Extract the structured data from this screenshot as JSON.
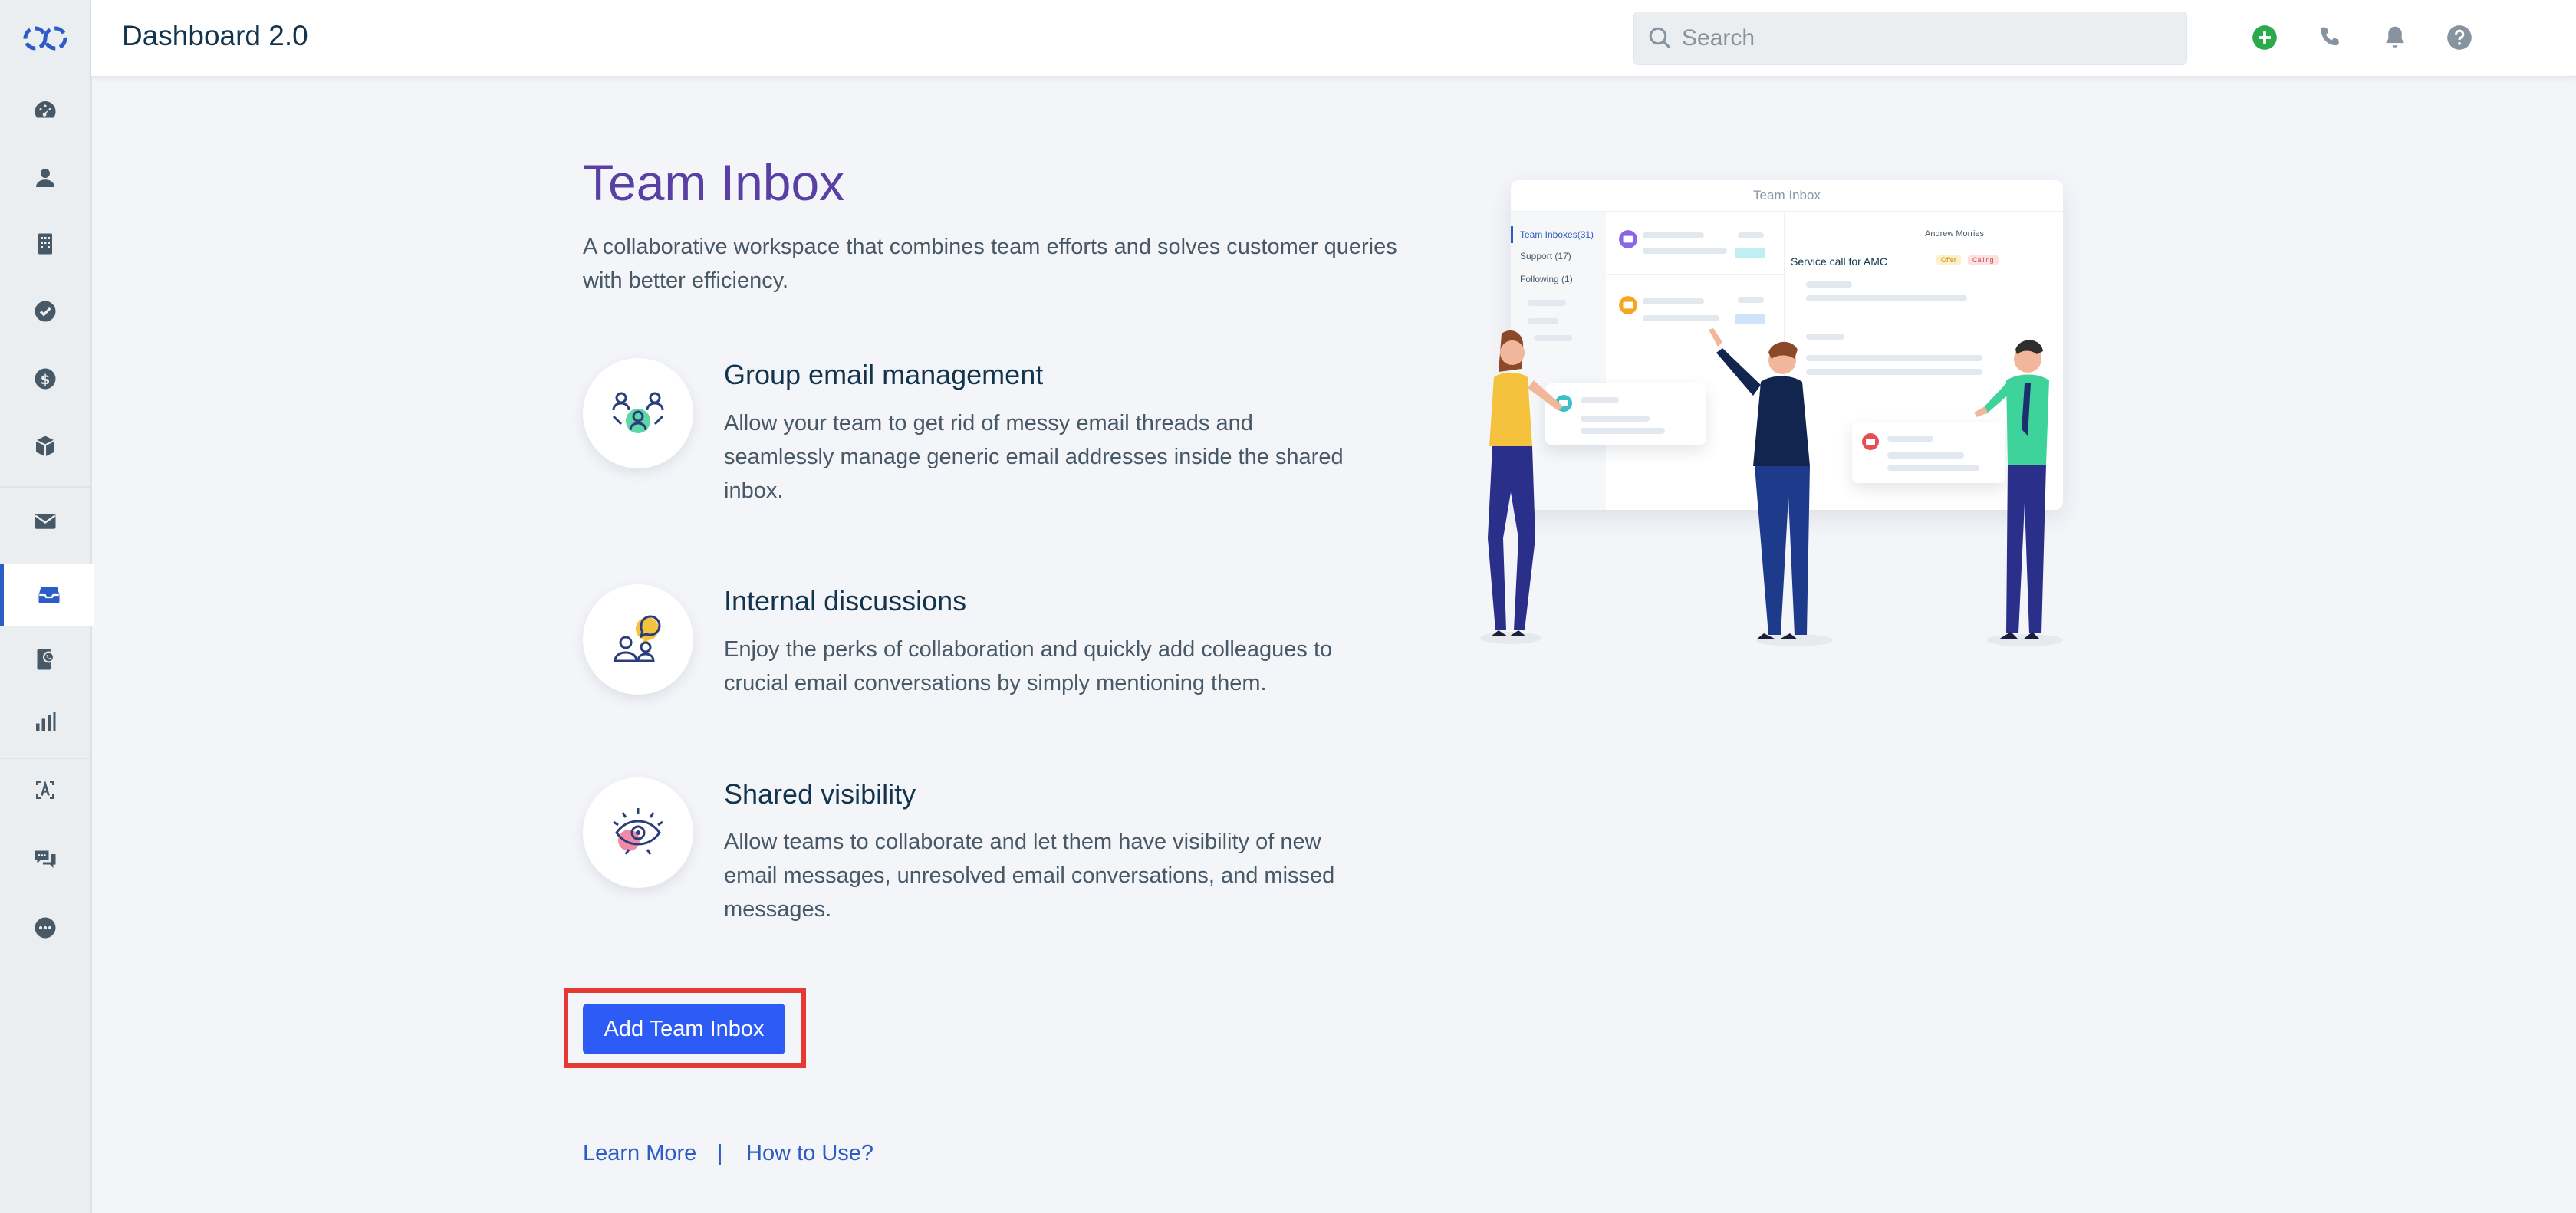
{
  "header": {
    "title": "Dashboard 2.0",
    "search_placeholder": "Search"
  },
  "sidebar": {
    "items": [
      {
        "icon": "dashboard-icon"
      },
      {
        "icon": "contacts-icon"
      },
      {
        "icon": "companies-icon"
      },
      {
        "icon": "tasks-icon"
      },
      {
        "icon": "deals-icon"
      },
      {
        "icon": "products-icon"
      },
      {
        "icon": "mail-icon"
      },
      {
        "icon": "team-inbox-icon",
        "active": true
      },
      {
        "icon": "phone-book-icon"
      },
      {
        "icon": "reports-icon"
      },
      {
        "icon": "automation-icon"
      },
      {
        "icon": "chat-icon"
      },
      {
        "icon": "more-icon"
      }
    ]
  },
  "page": {
    "title": "Team Inbox",
    "intro": "A collaborative workspace that combines team efforts and solves customer queries with better efficiency.",
    "features": [
      {
        "icon": "group-email-icon",
        "title": "Group email management",
        "description": "Allow your team to get rid of messy email threads and seamlessly manage generic email addresses inside the shared inbox."
      },
      {
        "icon": "discussion-icon",
        "title": "Internal discussions",
        "description": "Enjoy the perks of collaboration and quickly add colleagues to crucial email conversations by simply mentioning them."
      },
      {
        "icon": "visibility-eye-icon",
        "title": "Shared visibility",
        "description": "Allow teams to collaborate and let them have visibility of new email messages, unresolved email conversations, and missed messages."
      }
    ],
    "cta_label": "Add Team Inbox",
    "links": {
      "learn_more": "Learn More",
      "separator": "|",
      "how_to_use": "How to Use?"
    }
  },
  "illustration": {
    "mock_title": "Team Inbox",
    "side_items": [
      "Team Inboxes(31)",
      "Support (17)",
      "Following (1)"
    ],
    "detail_title": "Service call for AMC",
    "agent_name": "Andrew Morries",
    "tags": [
      "Offer",
      "Calling"
    ]
  },
  "colors": {
    "accent": "#2c5cf5",
    "title_purple": "#5a3fa5",
    "link_blue": "#2c5cc5",
    "highlight_red": "#e53935",
    "add_green": "#2ca94d"
  }
}
